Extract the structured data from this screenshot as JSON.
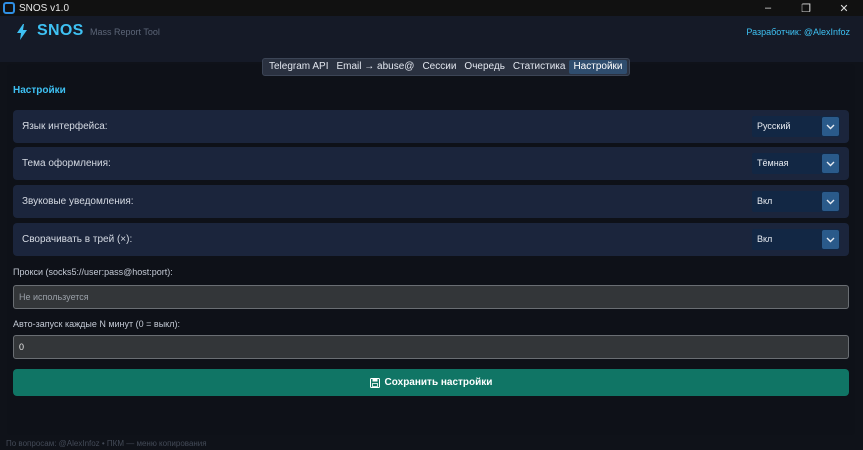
{
  "window": {
    "title": "SNOS v1.0",
    "minimize_glyph": "–",
    "maximize_glyph": "❐",
    "close_glyph": "✕"
  },
  "header": {
    "brand": "SNOS",
    "tagline": "Mass Report Tool",
    "developer": "Разработчик: @AlexInfoz"
  },
  "tabs": [
    {
      "label": "Telegram API",
      "active": false
    },
    {
      "label": "Email → abuse@",
      "active": false
    },
    {
      "label": "Сессии",
      "active": false
    },
    {
      "label": "Очередь",
      "active": false
    },
    {
      "label": "Статистика",
      "active": false
    },
    {
      "label": "Настройки",
      "active": true
    }
  ],
  "settings": {
    "title": "Настройки",
    "rows": [
      {
        "label": "Язык интерфейса:",
        "value": "Русский"
      },
      {
        "label": "Тема оформления:",
        "value": "Тёмная"
      },
      {
        "label": "Звуковые уведомления:",
        "value": "Вкл"
      },
      {
        "label": "Сворачивать в трей (×):",
        "value": "Вкл"
      }
    ],
    "proxy": {
      "label": "Прокси (socks5://user:pass@host:port):",
      "placeholder": "Не используется",
      "value": ""
    },
    "autostart": {
      "label": "Авто-запуск каждые N минут (0 = выкл):",
      "value": "0"
    },
    "save_label": "Сохранить настройки"
  },
  "footer": "По вопросам: @AlexInfoz  •  ПКМ — меню копирования",
  "colors": {
    "accent": "#3ec1f3",
    "row_bg": "#1b253c",
    "save_button": "#107565",
    "active_tab": "#2f4d6e"
  },
  "icons": {
    "app": "app-icon",
    "brand": "lightning-bolt-icon",
    "dropdown": "chevron-down-icon",
    "save": "floppy-disk-icon"
  }
}
